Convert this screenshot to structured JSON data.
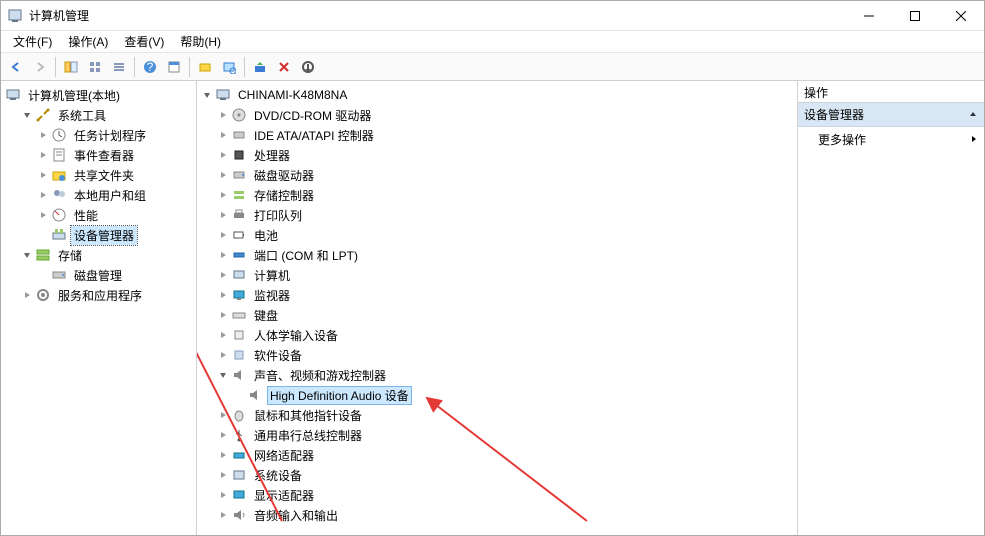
{
  "title": "计算机管理",
  "menus": {
    "file": "文件(F)",
    "action": "操作(A)",
    "view": "查看(V)",
    "help": "帮助(H)"
  },
  "left_tree": {
    "root": "计算机管理(本地)",
    "system_tools": "系统工具",
    "task_scheduler": "任务计划程序",
    "event_viewer": "事件查看器",
    "shared_folders": "共享文件夹",
    "local_users": "本地用户和组",
    "performance": "性能",
    "device_manager": "设备管理器",
    "storage": "存储",
    "disk_management": "磁盘管理",
    "services_apps": "服务和应用程序"
  },
  "devmgr": {
    "computer": "CHINAMI-K48M8NA",
    "dvd": "DVD/CD-ROM 驱动器",
    "ide": "IDE ATA/ATAPI 控制器",
    "cpu": "处理器",
    "disk_drives": "磁盘驱动器",
    "storage_ctl": "存储控制器",
    "print_queues": "打印队列",
    "battery": "电池",
    "ports": "端口 (COM 和 LPT)",
    "computers": "计算机",
    "monitors": "监视器",
    "keyboards": "键盘",
    "hid": "人体学输入设备",
    "software_devices": "软件设备",
    "sound": "声音、视频和游戏控制器",
    "hda": "High Definition Audio 设备",
    "mice": "鼠标和其他指针设备",
    "usb": "通用串行总线控制器",
    "net": "网络适配器",
    "system": "系统设备",
    "display": "显示适配器",
    "audio_io": "音频输入和输出"
  },
  "right": {
    "header": "操作",
    "section": "设备管理器",
    "more": "更多操作"
  }
}
